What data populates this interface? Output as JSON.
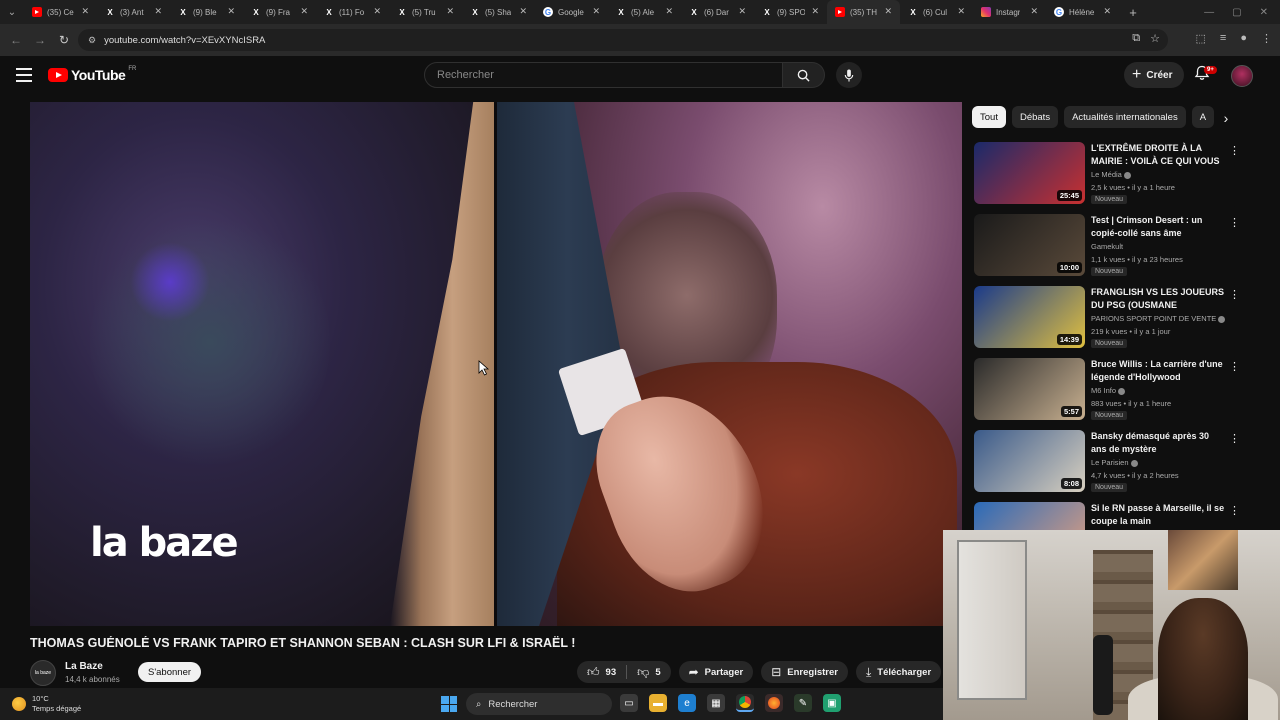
{
  "browser": {
    "tabs": [
      {
        "label": "(35) Ce",
        "icon": "youtube-icon",
        "color": "#ff0000",
        "active": false
      },
      {
        "label": "(3) Ant",
        "icon": "x-icon",
        "color": "#ffffff",
        "active": false
      },
      {
        "label": "(9) Ble",
        "icon": "x-icon",
        "color": "#ffffff",
        "active": false
      },
      {
        "label": "(9) Fra",
        "icon": "x-icon",
        "color": "#ffffff",
        "active": false
      },
      {
        "label": "(11) Fo",
        "icon": "x-icon",
        "color": "#ffffff",
        "active": false
      },
      {
        "label": "(5) Tru",
        "icon": "x-icon",
        "color": "#ffffff",
        "active": false
      },
      {
        "label": "(5) Sha",
        "icon": "x-icon",
        "color": "#ffffff",
        "active": false
      },
      {
        "label": "Google",
        "icon": "google-icon",
        "color": "#4285f4",
        "active": false
      },
      {
        "label": "(5) Ale",
        "icon": "x-icon",
        "color": "#ffffff",
        "active": false
      },
      {
        "label": "(6) Dar",
        "icon": "x-icon",
        "color": "#ffffff",
        "active": false
      },
      {
        "label": "(9) SPO",
        "icon": "x-icon",
        "color": "#ffffff",
        "active": false
      },
      {
        "label": "(35) TH",
        "icon": "youtube-icon",
        "color": "#ff0000",
        "active": true
      },
      {
        "label": "(6) Cul",
        "icon": "x-icon",
        "color": "#ffffff",
        "active": false
      },
      {
        "label": "Instagr",
        "icon": "instagram-icon",
        "color": "#e1306c",
        "active": false
      },
      {
        "label": "Hélène",
        "icon": "google-icon",
        "color": "#4285f4",
        "active": false
      }
    ],
    "url": "youtube.com/watch?v=XEvXYNcISRA"
  },
  "youtube": {
    "logo_text": "YouTube",
    "country": "FR",
    "search_placeholder": "Rechercher",
    "create_label": "Créer",
    "notif_count": "9+"
  },
  "video": {
    "watermark": "la baze",
    "title": "THOMAS GUÉNOLÉ VS FRANK TAPIRO ET SHANNON SEBAN : CLASH SUR LFI & ISRAËL !",
    "channel": {
      "name": "La Baze",
      "subscribers": "14,4 k abonnés",
      "avatar_text": "la baze"
    },
    "subscribe_label": "S'abonner",
    "likes": "93",
    "dislikes": "5",
    "share_label": "Partager",
    "save_label": "Enregistrer",
    "download_label": "Télécharger"
  },
  "chips": [
    "Tout",
    "Débats",
    "Actualités internationales",
    "A"
  ],
  "recommendations": [
    {
      "title": "L'EXTRÊME DROITE À LA MAIRIE : VOILÀ CE QUI VOUS ...",
      "channel": "Le Média",
      "verified": true,
      "meta": "2,5 k vues • il y a 1 heure",
      "badge": "Nouveau",
      "duration": "25:45",
      "thumb_colors": [
        "#1a2a6a",
        "#c83030"
      ]
    },
    {
      "title": "Test | Crimson Desert : un copié-collé sans âme",
      "channel": "Gamekult",
      "verified": false,
      "meta": "1,1 k vues • il y a 23 heures",
      "badge": "Nouveau",
      "duration": "10:00",
      "thumb_colors": [
        "#1a1a1a",
        "#5a4a3a"
      ]
    },
    {
      "title": "FRANGLISH VS LES JOUEURS DU PSG (OUSMANE DEMBÉLÉ,...",
      "channel": "PARIONS SPORT POINT DE VENTE",
      "verified": true,
      "meta": "219 k vues • il y a 1 jour",
      "badge": "Nouveau",
      "duration": "14:39",
      "thumb_colors": [
        "#1a3a8a",
        "#e0c040"
      ]
    },
    {
      "title": "Bruce Willis : La carrière d'une légende d'Hollywood",
      "channel": "M6 Info",
      "verified": true,
      "meta": "883 vues • il y a 1 heure",
      "badge": "Nouveau",
      "duration": "5:57",
      "thumb_colors": [
        "#2a2a2a",
        "#c8b090"
      ]
    },
    {
      "title": "Bansky démasqué après 30 ans de mystère",
      "channel": "Le Parisien",
      "verified": true,
      "meta": "4,7 k vues • il y a 2 heures",
      "badge": "Nouveau",
      "duration": "8:08",
      "thumb_colors": [
        "#3a5a8a",
        "#d8d0c0"
      ]
    },
    {
      "title": "Si le RN passe à Marseille, il se coupe la main",
      "channel": "",
      "verified": false,
      "meta": "",
      "badge": "",
      "duration": "",
      "thumb_colors": [
        "#2a6ab8",
        "#e0a080"
      ]
    }
  ],
  "taskbar": {
    "temperature": "10°C",
    "weather": "Temps dégagé",
    "search_label": "Rechercher"
  }
}
